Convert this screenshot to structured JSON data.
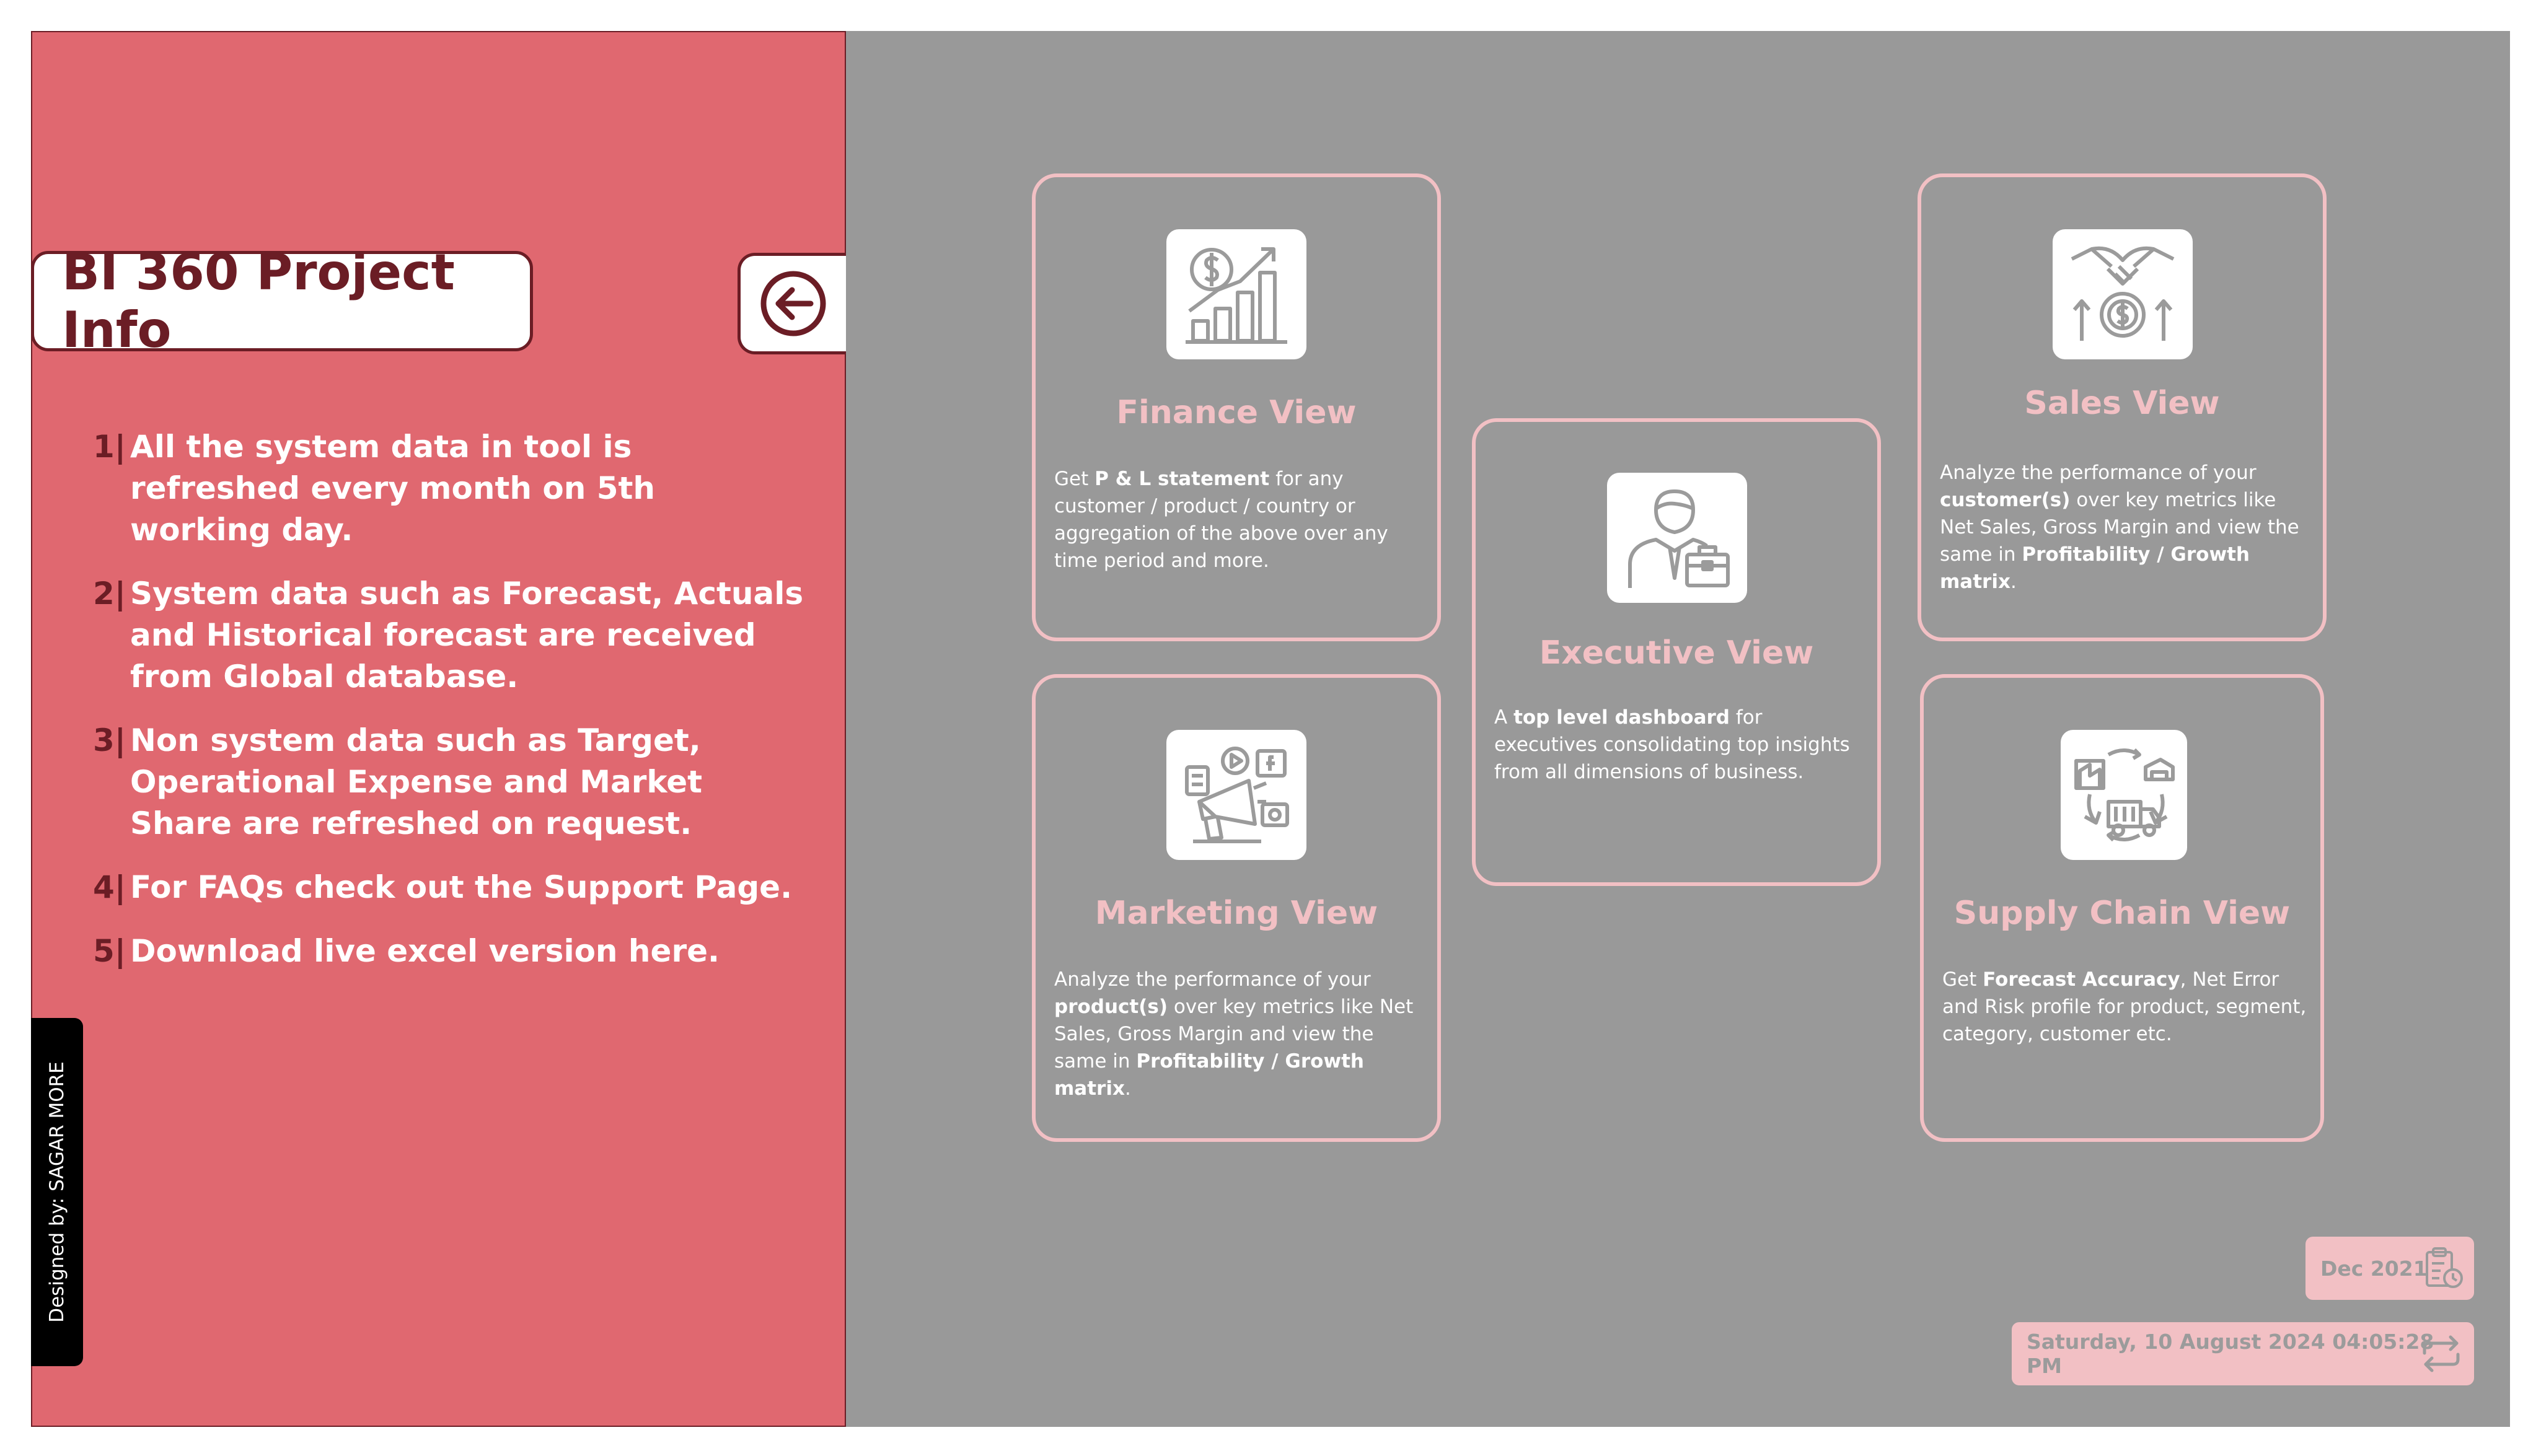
{
  "sidebar": {
    "title": "BI 360 Project Info",
    "items": [
      {
        "num": "1|",
        "text": "All the system data in tool is refreshed every month on 5th working day."
      },
      {
        "num": "2|",
        "text": "System data such as Forecast, Actuals and Historical forecast are received from Global database."
      },
      {
        "num": "3|",
        "text": "Non system data such as Target, Operational Expense and Market Share are refreshed on request."
      },
      {
        "num": "4|",
        "text": "For FAQs check out the Support Page."
      },
      {
        "num": "5|",
        "text": "Download live excel version here."
      }
    ],
    "designer": "Designed by: SAGAR MORE"
  },
  "cards": {
    "finance": {
      "title": "Finance View",
      "desc": {
        "p1": "Get ",
        "b1": "P & L statement",
        "p2": " for any customer / product / country or aggregation of the above over any time period and more."
      },
      "icon": "finance-growth-icon"
    },
    "executive": {
      "title": "Executive View",
      "desc": {
        "p1": "A ",
        "b1": "top level dashboard",
        "p2": " for executives consolidating top insights from all dimensions of business."
      },
      "icon": "businessman-icon"
    },
    "sales": {
      "title": "Sales View",
      "desc": {
        "p1": "Analyze the performance of your ",
        "b1": "customer(s)",
        "p2": " over key metrics like Net Sales, Gross Margin and view the same in ",
        "b2": "Profitability / Growth matrix",
        "p3": "."
      },
      "icon": "handshake-dollar-icon"
    },
    "marketing": {
      "title": "Marketing View",
      "desc": {
        "p1": "Analyze the performance of your ",
        "b1": "product(s)",
        "p2": " over key metrics like Net Sales, Gross Margin and view the same in ",
        "b2": "Profitability / Growth matrix",
        "p3": "."
      },
      "icon": "megaphone-media-icon"
    },
    "supply_chain": {
      "title": "Supply Chain View",
      "desc": {
        "p1": "Get ",
        "b1": "Forecast Accuracy",
        "p2": ", Net Error and Risk profile for product, segment, category, customer etc."
      },
      "icon": "supply-chain-icon"
    }
  },
  "footer": {
    "period": "Dec 2021",
    "refresh_time": "Saturday, 10 August 2024 04:05:28 PM"
  },
  "colors": {
    "left_bg": "#e06870",
    "right_bg": "#999999",
    "accent_dark": "#6b1d25",
    "card_border": "#f2c0c4"
  }
}
